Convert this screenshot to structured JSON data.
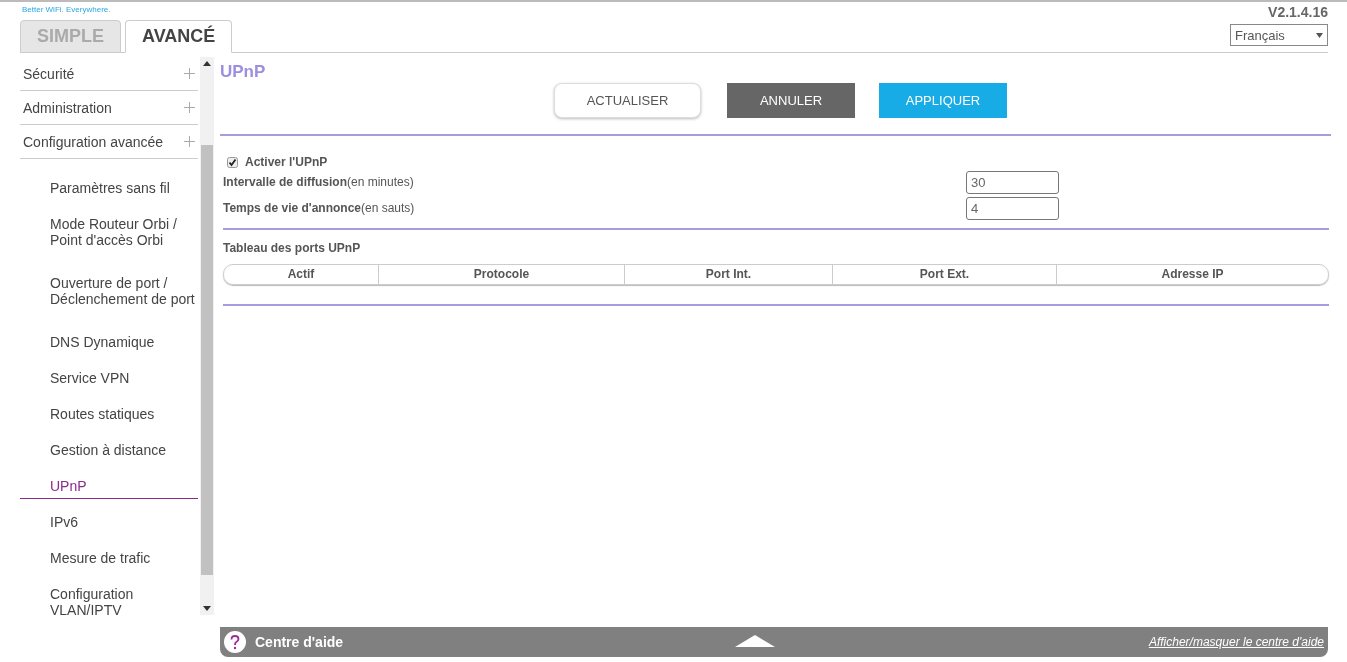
{
  "brand": {
    "tagline": "Better WiFi. Everywhere."
  },
  "version": "V2.1.4.16",
  "language": {
    "value": "Français"
  },
  "tabs": [
    {
      "label": "SIMPLE",
      "selected": false
    },
    {
      "label": "AVANCÉ",
      "selected": true
    }
  ],
  "sidebar": {
    "sections": [
      {
        "label": "Sécurité"
      },
      {
        "label": "Administration"
      },
      {
        "label": "Configuration avancée"
      }
    ],
    "items": [
      {
        "label": "Paramètres sans fil",
        "selected": false
      },
      {
        "label": "Mode Routeur Orbi /\nPoint d'accès Orbi",
        "selected": false
      },
      {
        "label": "Ouverture de port /\nDéclenchement de port",
        "selected": false
      },
      {
        "label": "DNS Dynamique",
        "selected": false
      },
      {
        "label": "Service VPN",
        "selected": false
      },
      {
        "label": "Routes statiques",
        "selected": false
      },
      {
        "label": "Gestion à distance",
        "selected": false
      },
      {
        "label": "UPnP",
        "selected": true
      },
      {
        "label": "IPv6",
        "selected": false
      },
      {
        "label": "Mesure de trafic",
        "selected": false
      },
      {
        "label": "Configuration\nVLAN/IPTV",
        "selected": false
      }
    ]
  },
  "page": {
    "title": "UPnP",
    "buttons": [
      {
        "label": "ACTUALISER",
        "kind": "outline"
      },
      {
        "label": "ANNULER",
        "kind": "dark"
      },
      {
        "label": "APPLIQUER",
        "kind": "primary"
      }
    ],
    "enable": {
      "label": "Activer l'UPnP",
      "checked": true
    },
    "fields": [
      {
        "label": "**Intervalle de diffusion**(en minutes)",
        "value": "30"
      },
      {
        "label": "**Temps de vie d'annonce**(en sauts)",
        "value": "4"
      }
    ],
    "table": {
      "title": "Tableau des ports UPnP",
      "columns": [
        "Actif",
        "Protocole",
        "Port Int.",
        "Port Ext.",
        "Adresse IP"
      ]
    }
  },
  "help_bar": {
    "title": "Centre d'aide",
    "link": "Afficher/masquer le centre d'aide"
  }
}
